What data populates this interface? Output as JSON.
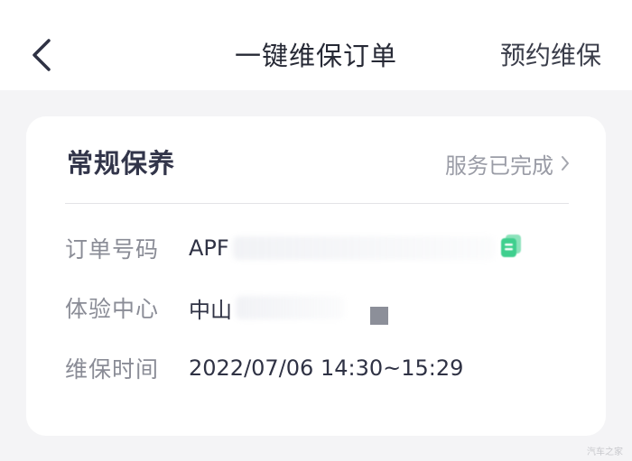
{
  "header": {
    "title": "一键维保订单",
    "action_label": "预约维保"
  },
  "order_card": {
    "title": "常规保养",
    "status_label": "服务已完成",
    "rows": [
      {
        "label": "订单号码",
        "value": "APF"
      },
      {
        "label": "体验中心",
        "value": "中山"
      },
      {
        "label": "维保时间",
        "value": "2022/07/06 14:30~15:29"
      }
    ]
  },
  "watermark": "汽车之家",
  "colors": {
    "accent_green": "#3fcf8e",
    "background": "#f4f4f6",
    "card": "#ffffff"
  },
  "icons": {
    "back": "chevron-left-icon",
    "status": "chevron-right-icon",
    "copy": "copy-icon"
  }
}
